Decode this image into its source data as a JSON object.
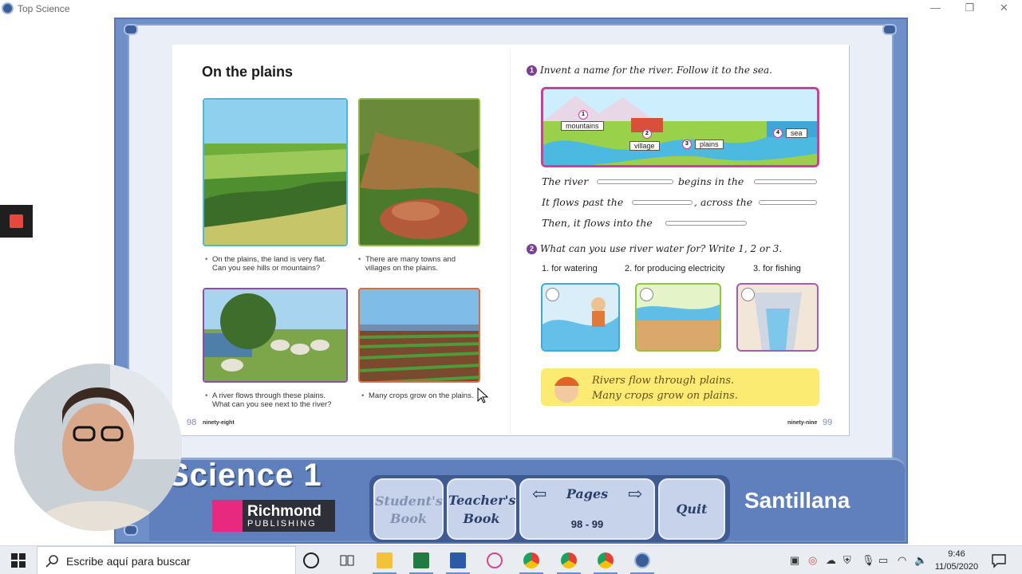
{
  "window": {
    "title": "Top Science"
  },
  "left_page": {
    "title": "On the plains",
    "captions": [
      [
        "On the plains, the land is very flat.",
        "Can you see hills or mountains?"
      ],
      [
        "There are many towns and",
        "villages on the plains."
      ],
      [
        "A river flows through these plains.",
        "What can you see next to the river?"
      ],
      [
        "Many crops grow on the plains."
      ]
    ],
    "page_number": "98",
    "page_word": "ninety-eight"
  },
  "right_page": {
    "q1": {
      "num": "1",
      "text": "Invent a name for the river. Follow it to the sea."
    },
    "map_labels": [
      {
        "num": "1",
        "label": "mountains"
      },
      {
        "num": "2",
        "label": "village"
      },
      {
        "num": "3",
        "label": "plains"
      },
      {
        "num": "4",
        "label": "sea"
      }
    ],
    "fill_lines": [
      {
        "a": "The river",
        "b": "begins in the"
      },
      {
        "a": "It flows past the",
        "b": ", across the"
      },
      {
        "a": "Then, it flows into the",
        "b": ""
      }
    ],
    "q2": {
      "num": "2",
      "text": "What can you use river water for? Write 1, 2 or 3."
    },
    "options": [
      "1. for watering",
      "2. for producing electricity",
      "3. for fishing"
    ],
    "summary": [
      "Rivers flow through plains.",
      "Many crops grow on plains."
    ],
    "page_number": "99",
    "page_word": "ninety-nine"
  },
  "banner": {
    "brand": "Science 1",
    "publisher_name": "Richmond",
    "publisher_sub": "PUBLISHING",
    "nav": {
      "student_book": [
        "Student's",
        "Book"
      ],
      "teacher_book": [
        "Teacher's",
        "Book"
      ],
      "pages_label": "Pages",
      "pages_value": "98 - 99",
      "quit": "Quit"
    },
    "santillana": "Santillana"
  },
  "taskbar": {
    "search_placeholder": "Escribe aquí para buscar",
    "time": "9:46",
    "date": "11/05/2020"
  },
  "colors": {
    "frame": "#6f8fc8",
    "banner": "#5f7fbd",
    "accent_pink": "#cc3f9a",
    "summary_yellow": "#fbeb72"
  }
}
